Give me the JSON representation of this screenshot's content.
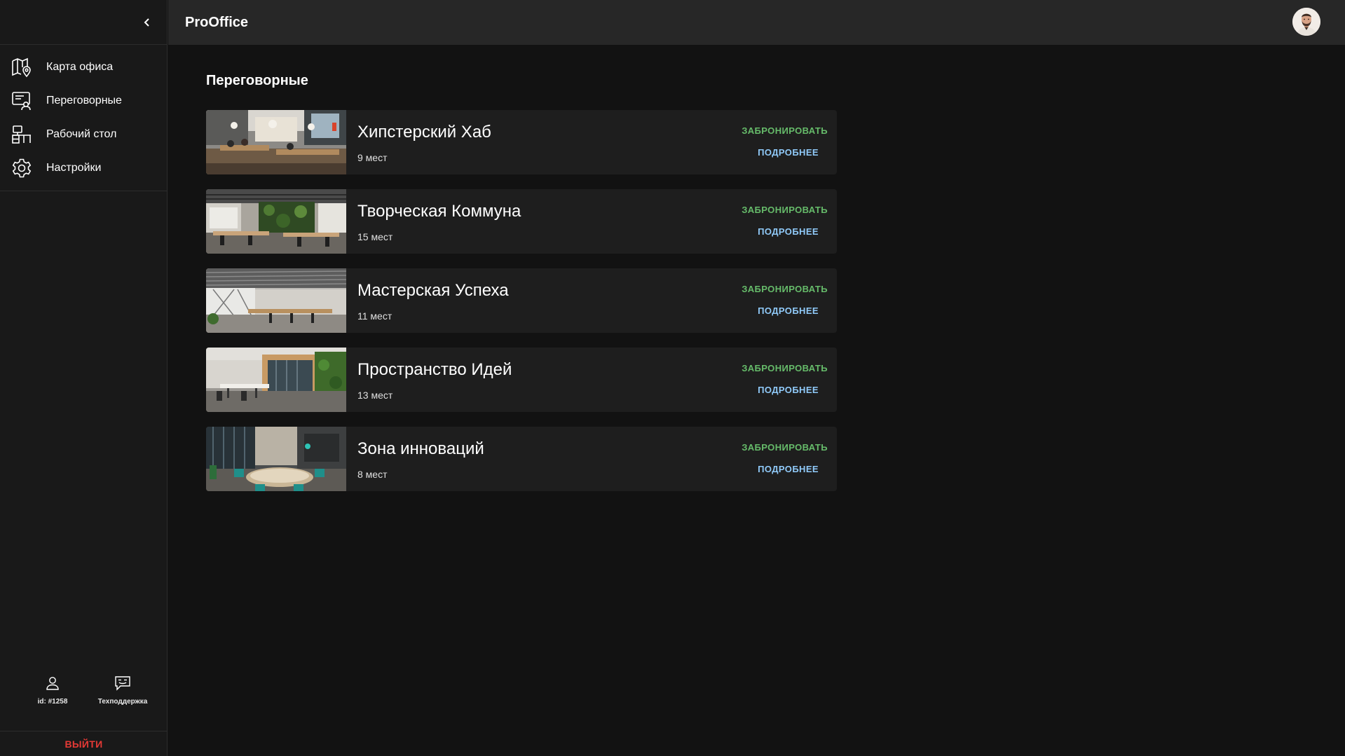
{
  "app": {
    "title": "ProOffice"
  },
  "sidebar": {
    "items": [
      {
        "label": "Карта офиса",
        "icon": "office-map-icon"
      },
      {
        "label": "Переговорные",
        "icon": "meeting-room-icon"
      },
      {
        "label": "Рабочий стол",
        "icon": "desk-icon"
      },
      {
        "label": "Настройки",
        "icon": "gear-icon"
      }
    ],
    "user_id": "id: #1258",
    "support": "Техподдержка",
    "logout": "ВЫЙТИ"
  },
  "page": {
    "title": "Переговорные"
  },
  "rooms": [
    {
      "name": "Хипстерский Хаб",
      "seats": "9 мест",
      "book": "ЗАБРОНИРОВАТЬ",
      "more": "ПОДРОБНЕЕ"
    },
    {
      "name": "Творческая Коммуна",
      "seats": "15 мест",
      "book": "ЗАБРОНИРОВАТЬ",
      "more": "ПОДРОБНЕЕ"
    },
    {
      "name": "Мастерская Успеха",
      "seats": "11 мест",
      "book": "ЗАБРОНИРОВАТЬ",
      "more": "ПОДРОБНЕЕ"
    },
    {
      "name": "Пространство Идей",
      "seats": "13 мест",
      "book": "ЗАБРОНИРОВАТЬ",
      "more": "ПОДРОБНЕЕ"
    },
    {
      "name": "Зона инноваций",
      "seats": "8 мест",
      "book": "ЗАБРОНИРОВАТЬ",
      "more": "ПОДРОБНЕЕ"
    }
  ],
  "colors": {
    "accent_green": "#66bb6a",
    "accent_blue": "#90caf9",
    "logout_red": "#e53935",
    "background": "#121212",
    "topbar": "#272727"
  }
}
